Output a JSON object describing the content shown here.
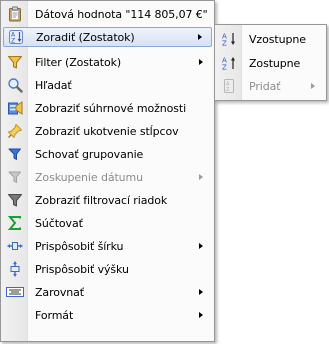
{
  "main_menu": {
    "items": [
      {
        "label": "Dátová hodnota \"114 805,07 €\"",
        "icon": "clipboard-icon",
        "submenu": false,
        "disabled": false
      },
      {
        "label": "Zoradiť (Zostatok)",
        "icon": "sort-icon",
        "submenu": true,
        "disabled": false,
        "highlighted": true
      },
      {
        "label": "Filter (Zostatok)",
        "icon": "filter-icon",
        "submenu": true,
        "disabled": false
      },
      {
        "label": "Hľadať",
        "icon": "search-icon",
        "submenu": false,
        "disabled": false
      },
      {
        "label": "Zobraziť súhrnové možnosti",
        "icon": "summary-options-icon",
        "submenu": false,
        "disabled": false
      },
      {
        "label": "Zobraziť ukotvenie stĺpcov",
        "icon": "pin-icon",
        "submenu": false,
        "disabled": false
      },
      {
        "label": "Schovať grupovanie",
        "icon": "group-filter-icon",
        "submenu": false,
        "disabled": false
      },
      {
        "label": "Zoskupenie dátumu",
        "icon": "date-group-icon",
        "submenu": true,
        "disabled": true
      },
      {
        "label": "Zobraziť filtrovací riadok",
        "icon": "filter-row-icon",
        "submenu": false,
        "disabled": false
      },
      {
        "label": "Súčtovať",
        "icon": "sum-icon",
        "submenu": false,
        "disabled": false
      },
      {
        "label": "Prispôsobiť šírku",
        "icon": "fit-width-icon",
        "submenu": true,
        "disabled": false
      },
      {
        "label": "Prispôsobiť výšku",
        "icon": "fit-height-icon",
        "submenu": false,
        "disabled": false
      },
      {
        "label": "Zarovnať",
        "icon": "align-icon",
        "submenu": true,
        "disabled": false
      },
      {
        "label": "Formát",
        "icon": "format-icon",
        "submenu": true,
        "disabled": false
      }
    ]
  },
  "sub_menu": {
    "items": [
      {
        "label": "Vzostupne",
        "icon": "sort-ascending-icon",
        "submenu": false,
        "disabled": false
      },
      {
        "label": "Zostupne",
        "icon": "sort-descending-icon",
        "submenu": false,
        "disabled": false
      },
      {
        "label": "Pridať",
        "icon": "add-sort-icon",
        "submenu": true,
        "disabled": true
      }
    ]
  },
  "colors": {
    "highlight_border": "#8aa8da",
    "highlight_fill": "#d6e2f5",
    "disabled_text": "#8d8d8d"
  }
}
